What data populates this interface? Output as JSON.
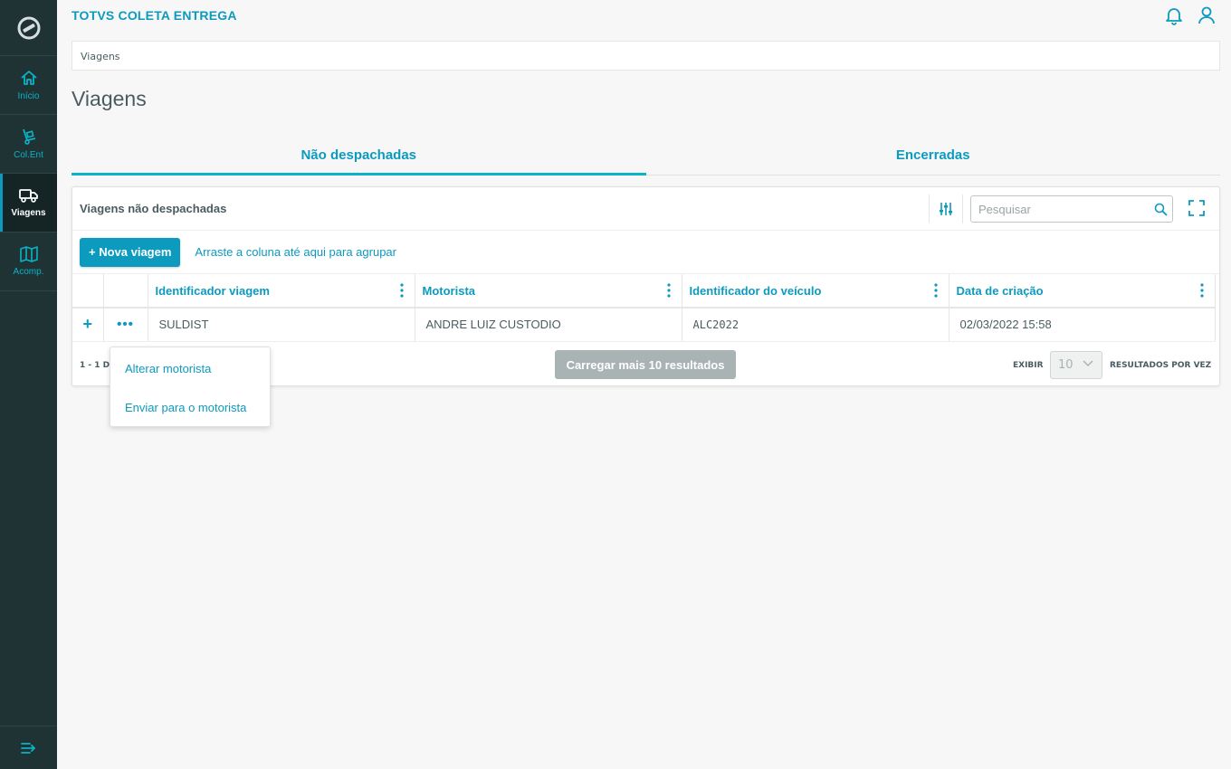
{
  "colors": {
    "accent": "#0c9abe",
    "sidebar_bg": "#1f3335",
    "disabled": "#a9b3b4"
  },
  "sidebar": {
    "logo_icon": "totvs-logo-icon",
    "items": [
      {
        "label": "Início",
        "icon": "home-icon"
      },
      {
        "label": "Col.Ent",
        "icon": "hand-truck-icon"
      },
      {
        "label": "Viagens",
        "icon": "truck-icon",
        "active": true
      },
      {
        "label": "Acomp.",
        "icon": "map-icon"
      }
    ],
    "collapse_icon": "collapse-menu-icon"
  },
  "header": {
    "app_title": "TOTVS COLETA ENTREGA",
    "icons": [
      "bell-icon",
      "user-icon"
    ]
  },
  "breadcrumb": "Viagens",
  "page_title": "Viagens",
  "tabs": [
    {
      "label": "Não despachadas",
      "active": true
    },
    {
      "label": "Encerradas",
      "active": false
    }
  ],
  "card": {
    "title": "Viagens não despachadas",
    "search_placeholder": "Pesquisar",
    "new_button": "+ Nova viagem",
    "group_hint": "Arraste a coluna até aqui para agrupar",
    "columns": [
      "Identificador viagem",
      "Motorista",
      "Identificador do veículo",
      "Data de criação"
    ],
    "rows": [
      {
        "plus": "+",
        "dots": "•••",
        "identificador": "SULDIST",
        "motorista": "ANDRE LUIZ CUSTODIO",
        "veiculo": "ALC2022",
        "data": "02/03/2022 15:58"
      }
    ],
    "range_text": "1 - 1 DE",
    "load_more": "Carregar mais 10 resultados",
    "exibir": "EXIBIR",
    "page_size": "10",
    "resultados": "RESULTADOS POR VEZ"
  },
  "row_menu": {
    "items": [
      "Alterar motorista",
      "Enviar para o motorista"
    ]
  }
}
